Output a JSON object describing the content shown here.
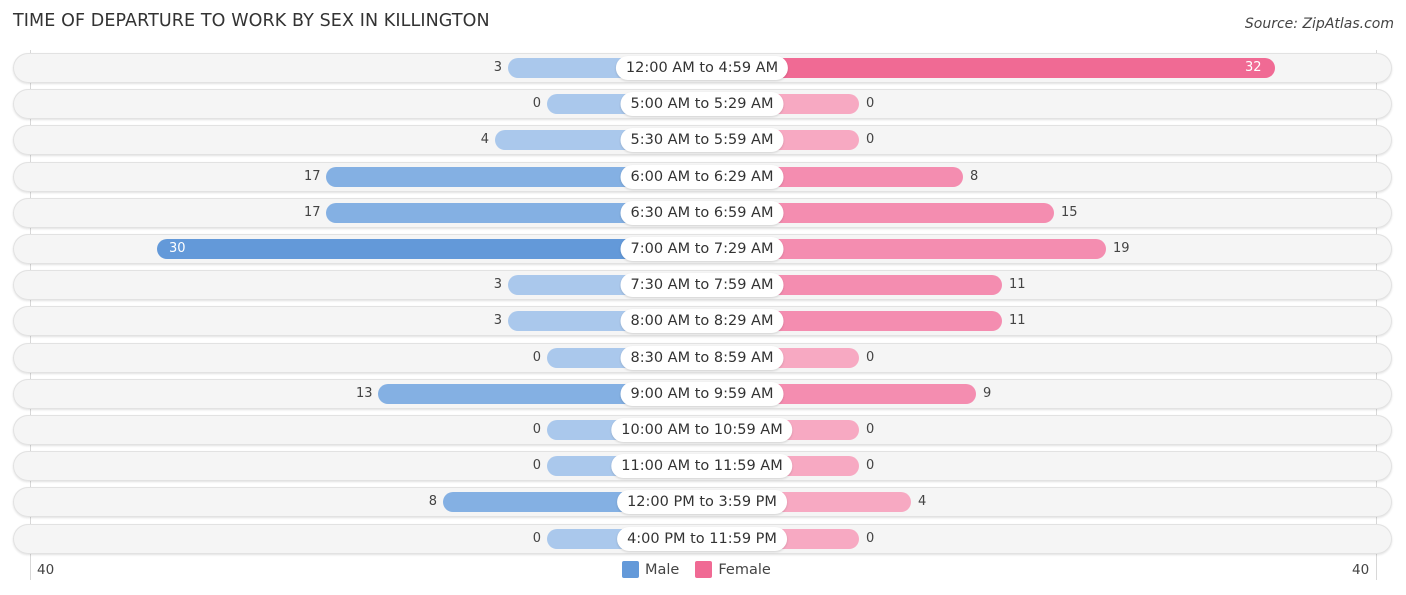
{
  "title": "TIME OF DEPARTURE TO WORK BY SEX IN KILLINGTON",
  "source": "Source: ZipAtlas.com",
  "colors": {
    "male_strong": "#6399d9",
    "male_mid": "#84b0e3",
    "male_light": "#aac8ec",
    "female_strong": "#f06a94",
    "female_mid": "#f48db0",
    "female_light": "#f7a9c2"
  },
  "chart_data": {
    "type": "bar",
    "orientation": "horizontal-diverging",
    "title": "TIME OF DEPARTURE TO WORK BY SEX IN KILLINGTON",
    "categories": [
      "12:00 AM to 4:59 AM",
      "5:00 AM to 5:29 AM",
      "5:30 AM to 5:59 AM",
      "6:00 AM to 6:29 AM",
      "6:30 AM to 6:59 AM",
      "7:00 AM to 7:29 AM",
      "7:30 AM to 7:59 AM",
      "8:00 AM to 8:29 AM",
      "8:30 AM to 8:59 AM",
      "9:00 AM to 9:59 AM",
      "10:00 AM to 10:59 AM",
      "11:00 AM to 11:59 AM",
      "12:00 PM to 3:59 PM",
      "4:00 PM to 11:59 PM"
    ],
    "series": [
      {
        "name": "Male",
        "side": "left",
        "values": [
          3,
          0,
          4,
          17,
          17,
          30,
          3,
          3,
          0,
          13,
          0,
          0,
          8,
          0
        ]
      },
      {
        "name": "Female",
        "side": "right",
        "values": [
          32,
          0,
          0,
          8,
          15,
          19,
          11,
          11,
          0,
          9,
          0,
          0,
          4,
          0
        ]
      }
    ],
    "axis": {
      "left_label": "40",
      "right_label": "40",
      "max": 40
    },
    "legend": {
      "position": "bottom-center",
      "items": [
        "Male",
        "Female"
      ]
    },
    "grid": false
  }
}
